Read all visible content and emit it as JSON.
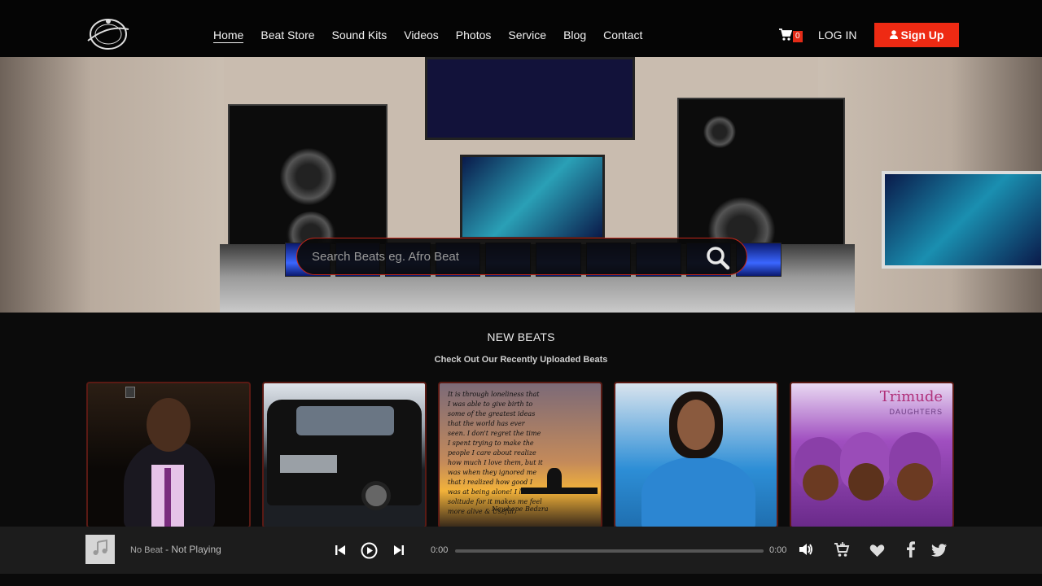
{
  "header": {
    "logo_icon": "logo-icon",
    "nav": [
      {
        "label": "Home",
        "active": true
      },
      {
        "label": "Beat Store"
      },
      {
        "label": "Sound Kits"
      },
      {
        "label": "Videos"
      },
      {
        "label": "Photos"
      },
      {
        "label": "Service"
      },
      {
        "label": "Blog"
      },
      {
        "label": "Contact"
      }
    ],
    "cart_count": "0",
    "login_label": "LOG IN",
    "signup_label": "Sign Up",
    "accent_color": "#ee2a13"
  },
  "hero": {
    "search_placeholder": "Search Beats eg. Afro Beat",
    "search_value": ""
  },
  "new_beats": {
    "title": "NEW BEATS",
    "subtitle": "Check Out Our Recently Uploaded Beats",
    "cards": [
      {
        "kind": "portrait-man"
      },
      {
        "kind": "black-suv"
      },
      {
        "kind": "quote",
        "text": "It is through loneliness that I was able to give birth to some of the greatest ideas that the world has ever seen. I don't regret the time I spent trying to make the people I care about realize how much I love them, but it was when they ignored me that i realized how good I was at being alone! I love solitude for it makes me feel more alive & Useful.",
        "signature": "Newhope Bedzra"
      },
      {
        "kind": "portrait-woman"
      },
      {
        "kind": "album",
        "title": "Trimude",
        "subtitle": "DAUGHTERS"
      }
    ]
  },
  "player": {
    "track_title": "No Beat",
    "track_separator": " - ",
    "track_status": "Not Playing",
    "time_current": "0:00",
    "time_total": "0:00",
    "progress": 0
  }
}
